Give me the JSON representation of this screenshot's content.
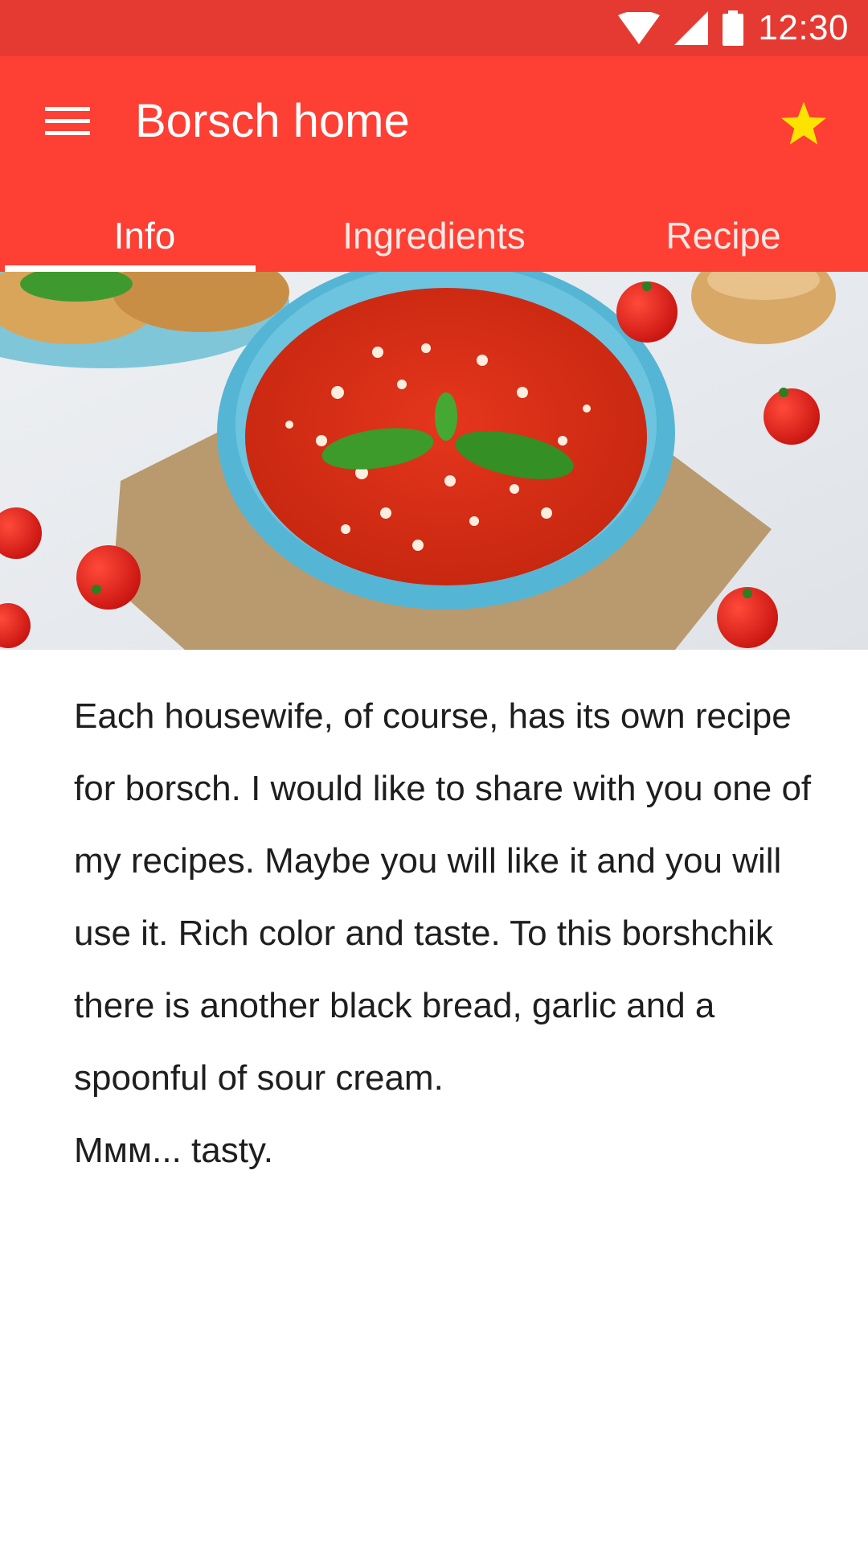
{
  "status_bar": {
    "time": "12:30"
  },
  "app_bar": {
    "title": "Borsch home"
  },
  "tabs": [
    {
      "label": "Info",
      "active": true
    },
    {
      "label": "Ingredients",
      "active": false
    },
    {
      "label": "Recipe",
      "active": false
    }
  ],
  "colors": {
    "status_bar": "#e53a32",
    "app_bar": "#fe3f34",
    "star": "#ffe300"
  },
  "icons": [
    "wifi-icon",
    "signal-icon",
    "battery-icon",
    "menu-icon",
    "star-icon"
  ],
  "article": {
    "paragraph": "Each housewife, of course, has its own recipe for borsch. I would like to share with you one of my recipes. Maybe you will like it and you will use it. Rich color and taste. To this borshchik there is another black bread, garlic and a spoonful of sour cream.",
    "closing": "Ммм... tasty."
  }
}
